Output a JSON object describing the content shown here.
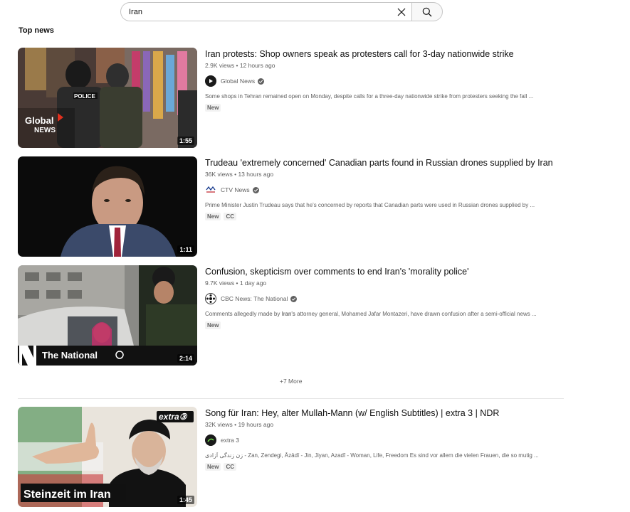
{
  "search": {
    "value": "Iran"
  },
  "section": {
    "title": "Top news"
  },
  "items": [
    {
      "title": "Iran protests: Shop owners speak as protesters call for 3-day nationwide strike",
      "views": "2.9K views",
      "age": "12 hours ago",
      "channel": "Global News",
      "description": "Some shops in Tehran remained open on Monday, despite calls for a three-day nationwide strike from protesters seeking the fall ...",
      "badges": [
        "New"
      ],
      "duration": "1:55",
      "thumb_text_1": "Global",
      "thumb_text_2": "NEWS",
      "thumb_text_3": "POLICE"
    },
    {
      "title": "Trudeau 'extremely concerned' Canadian parts found in Russian drones supplied by Iran",
      "views": "36K views",
      "age": "13 hours ago",
      "channel": "CTV News",
      "description": "Prime Minister Justin Trudeau says that he's concerned by reports that Canadian parts were used in Russian drones supplied by ...",
      "badges": [
        "New",
        "CC"
      ],
      "duration": "1:11"
    },
    {
      "title": "Confusion, skepticism over comments to end Iran's 'morality police'",
      "views": "9.7K views",
      "age": "1 day ago",
      "channel": "CBC News: The National",
      "description_pre": "Comments allegedly made by ",
      "description_hl": "Iran's",
      "description_post": " attorney general, Mohamed Jafar Montazeri, have drawn confusion after a semi-official news ...",
      "badges": [
        "New"
      ],
      "duration": "2:14",
      "thumb_text_1": "The National"
    },
    {
      "title": "Song für Iran: Hey, alter Mullah-Mann (w/ English Subtitles) | extra 3 | NDR",
      "views": "32K views",
      "age": "19 hours ago",
      "channel": "extra 3",
      "description": "زن زندگی آزادی - Zan, Zendegi, Āzādī - Jin, Jiyan, Azadî - Woman, Life, Freedom Es sind vor allem die vielen Frauen, die so mutig ...",
      "badges": [
        "New",
        "CC"
      ],
      "duration": "1:45",
      "thumb_text_1": "Steinzeit im Iran",
      "thumb_text_2": "extra③"
    }
  ],
  "more": {
    "label": "+7 More"
  },
  "colors": {
    "accent": "#065fd4",
    "meta": "#606060",
    "badge_bg": "#f2f2f2"
  }
}
